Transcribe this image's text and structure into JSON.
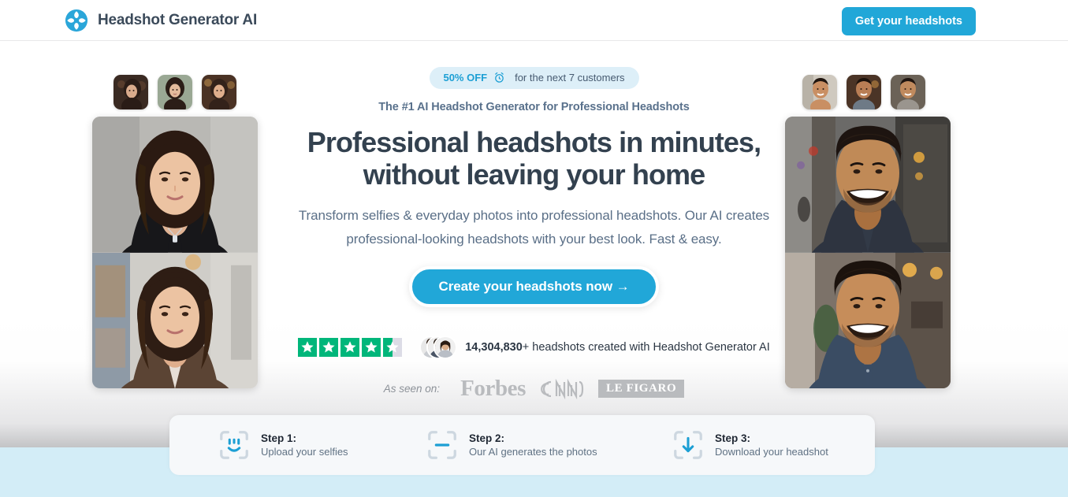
{
  "header": {
    "brand_name": "Headshot Generator AI",
    "logo_icon": "headshot-logo-icon",
    "cta_label": "Get your headshots"
  },
  "hero": {
    "promo": {
      "discount": "50% OFF",
      "clock_icon": "alarm-clock-icon",
      "rest": "for the next 7 customers"
    },
    "eyebrow": "The #1 AI Headshot Generator for Professional Headshots",
    "headline_line1": "Professional headshots in minutes,",
    "headline_line2": "without leaving your home",
    "subhead": "Transform selfies & everyday photos into professional headshots. Our AI creates professional-looking headshots with your best look. Fast & easy.",
    "cta_label": "Create your headshots now →"
  },
  "social_proof": {
    "rating_stars": 4.5,
    "star_count": 5,
    "count": "14,304,830",
    "count_suffix": "+",
    "text": " headshots created with Headshot Generator AI",
    "avatars": [
      "avatar-woman-left",
      "avatar-man-center",
      "avatar-woman-right"
    ]
  },
  "press": {
    "label": "As seen on:",
    "logos": [
      "Forbes",
      "CNN",
      "LE FIGARO"
    ]
  },
  "images": {
    "left_thumbs": [
      "thumb-woman-1",
      "thumb-woman-2",
      "thumb-woman-3"
    ],
    "right_thumbs": [
      "thumb-man-1",
      "thumb-man-2",
      "thumb-man-3"
    ],
    "left_large": [
      "headshot-woman-blazer-black",
      "headshot-woman-blazer-brown"
    ],
    "right_large": [
      "headshot-man-suit-street",
      "headshot-man-denim-shirt"
    ]
  },
  "steps": [
    {
      "title": "Step 1:",
      "desc": "Upload your selfies",
      "icon": "scan-face-icon"
    },
    {
      "title": "Step 2:",
      "desc": "Our AI generates the photos",
      "icon": "scan-line-icon"
    },
    {
      "title": "Step 3:",
      "desc": "Download your headshot",
      "icon": "scan-download-icon"
    }
  ],
  "colors": {
    "accent": "#21a7d8",
    "headline": "#33414f",
    "body_text": "#5a6f87",
    "badge_bg": "#ddeff8",
    "star_green": "#00b67a",
    "star_grey": "#dcdce6",
    "band_blue": "#d3edf7",
    "steps_card_bg": "#f6f8fa"
  }
}
